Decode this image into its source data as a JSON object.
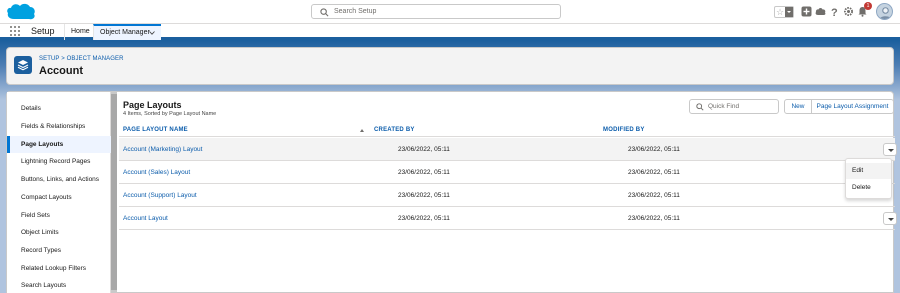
{
  "header": {
    "search_placeholder": "Search Setup",
    "notification_count": "1"
  },
  "context_bar": {
    "app_name": "Setup",
    "tabs": [
      {
        "label": "Home"
      },
      {
        "label": "Object Manager"
      }
    ]
  },
  "page_header": {
    "breadcrumb_setup": "SETUP",
    "breadcrumb_sep": ">",
    "breadcrumb_object_manager": "OBJECT MANAGER",
    "title": "Account"
  },
  "sidebar": {
    "items": [
      {
        "label": "Details"
      },
      {
        "label": "Fields & Relationships"
      },
      {
        "label": "Page Layouts"
      },
      {
        "label": "Lightning Record Pages"
      },
      {
        "label": "Buttons, Links, and Actions"
      },
      {
        "label": "Compact Layouts"
      },
      {
        "label": "Field Sets"
      },
      {
        "label": "Object Limits"
      },
      {
        "label": "Record Types"
      },
      {
        "label": "Related Lookup Filters"
      },
      {
        "label": "Search Layouts"
      }
    ],
    "active_index": 2
  },
  "content": {
    "title": "Page Layouts",
    "subtitle": "4 Items, Sorted by Page Layout Name",
    "quick_find_placeholder": "Quick Find",
    "new_button": "New",
    "assignment_button": "Page Layout Assignment",
    "columns": {
      "name": "PAGE LAYOUT NAME",
      "created_by": "CREATED BY",
      "modified_by": "MODIFIED BY"
    },
    "rows": [
      {
        "name": "Account (Marketing) Layout",
        "created": "23/06/2022, 05:11",
        "modified": "23/06/2022, 05:11"
      },
      {
        "name": "Account (Sales) Layout",
        "created": "23/06/2022, 05:11",
        "modified": "23/06/2022, 05:11"
      },
      {
        "name": "Account (Support) Layout",
        "created": "23/06/2022, 05:11",
        "modified": "23/06/2022, 05:11"
      },
      {
        "name": "Account Layout",
        "created": "23/06/2022, 05:11",
        "modified": "23/06/2022, 05:11"
      }
    ]
  },
  "menu": {
    "items": [
      {
        "label": "Edit"
      },
      {
        "label": "Delete"
      }
    ]
  },
  "colors": {
    "brand": "#0176d3",
    "link": "#0b5cab",
    "band": "#1b5f9e",
    "notification": "#c23934"
  },
  "icons": [
    "salesforce-cloud-logo",
    "search-icon",
    "star-icon",
    "add-icon",
    "cloud-icon",
    "help-icon",
    "gear-icon",
    "bell-icon",
    "app-launcher-icon",
    "layers-icon",
    "chevron-down-icon"
  ]
}
